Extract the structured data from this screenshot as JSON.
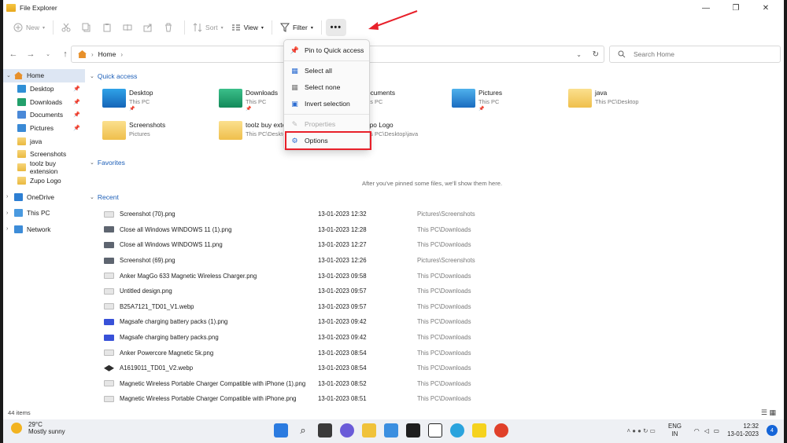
{
  "window": {
    "title": "File Explorer"
  },
  "toolbar": {
    "new_label": "New",
    "sort_label": "Sort",
    "view_label": "View",
    "filter_label": "Filter",
    "more_label": "•••"
  },
  "address": {
    "path": "Home"
  },
  "search": {
    "placeholder": "Search Home"
  },
  "sidebar": {
    "items": [
      {
        "label": "Home",
        "icon": "home-icon"
      },
      {
        "label": "Desktop",
        "icon": "desktop-folder-icon"
      },
      {
        "label": "Downloads",
        "icon": "downloads-folder-icon"
      },
      {
        "label": "Documents",
        "icon": "documents-folder-icon"
      },
      {
        "label": "Pictures",
        "icon": "pictures-folder-icon"
      },
      {
        "label": "java",
        "icon": "folder-icon"
      },
      {
        "label": "Screenshots",
        "icon": "folder-icon"
      },
      {
        "label": "toolz buy extension",
        "icon": "folder-icon"
      },
      {
        "label": "Zupo Logo",
        "icon": "folder-icon"
      },
      {
        "label": "OneDrive",
        "icon": "onedrive-icon"
      },
      {
        "label": "This PC",
        "icon": "pc-icon"
      },
      {
        "label": "Network",
        "icon": "network-icon"
      }
    ]
  },
  "quick_access": {
    "title": "Quick access",
    "tiles": [
      {
        "name": "Desktop",
        "sub": "This PC"
      },
      {
        "name": "Downloads",
        "sub": "This PC"
      },
      {
        "name": "Documents",
        "sub": "This PC"
      },
      {
        "name": "Pictures",
        "sub": "This PC"
      },
      {
        "name": "java",
        "sub": "This PC\\Desktop"
      },
      {
        "name": "Screenshots",
        "sub": "Pictures"
      },
      {
        "name": "toolz buy extension",
        "sub": "This PC\\Desktop"
      },
      {
        "name": "Zupo Logo",
        "sub": "This PC\\Desktop\\java"
      }
    ]
  },
  "favorites": {
    "title": "Favorites",
    "empty_message": "After you've pinned some files, we'll show them here."
  },
  "recent": {
    "title": "Recent",
    "rows": [
      {
        "name": "Screenshot (70).png",
        "date": "13-01-2023 12:32",
        "location": "Pictures\\Screenshots"
      },
      {
        "name": "Close all Windows WINDOWS 11 (1).png",
        "date": "13-01-2023 12:28",
        "location": "This PC\\Downloads"
      },
      {
        "name": "Close all Windows WINDOWS 11.png",
        "date": "13-01-2023 12:27",
        "location": "This PC\\Downloads"
      },
      {
        "name": "Screenshot (69).png",
        "date": "13-01-2023 12:26",
        "location": "Pictures\\Screenshots"
      },
      {
        "name": "Anker MagGo 633 Magnetic Wireless Charger.png",
        "date": "13-01-2023 09:58",
        "location": "This PC\\Downloads"
      },
      {
        "name": "Untitled design.png",
        "date": "13-01-2023 09:57",
        "location": "This PC\\Downloads"
      },
      {
        "name": "B25A7121_TD01_V1.webp",
        "date": "13-01-2023 09:57",
        "location": "This PC\\Downloads"
      },
      {
        "name": "Magsafe charging battery packs (1).png",
        "date": "13-01-2023 09:42",
        "location": "This PC\\Downloads"
      },
      {
        "name": "Magsafe charging battery packs.png",
        "date": "13-01-2023 09:42",
        "location": "This PC\\Downloads"
      },
      {
        "name": "Anker Powercore Magnetic 5k.png",
        "date": "13-01-2023 08:54",
        "location": "This PC\\Downloads"
      },
      {
        "name": "A1619011_TD01_V2.webp",
        "date": "13-01-2023 08:54",
        "location": "This PC\\Downloads"
      },
      {
        "name": "Magnetic Wireless Portable Charger Compatible with iPhone (1).png",
        "date": "13-01-2023 08:52",
        "location": "This PC\\Downloads"
      },
      {
        "name": "Magnetic Wireless Portable Charger Compatible with iPhone.png",
        "date": "13-01-2023 08:51",
        "location": "This PC\\Downloads"
      }
    ]
  },
  "status": {
    "item_count": "44 items"
  },
  "menu": {
    "items": [
      {
        "label": "Pin to Quick access",
        "icon": "pin-icon",
        "enabled": true
      },
      {
        "label": "Select all",
        "icon": "select-all-icon",
        "enabled": true
      },
      {
        "label": "Select none",
        "icon": "select-none-icon",
        "enabled": true
      },
      {
        "label": "Invert selection",
        "icon": "invert-selection-icon",
        "enabled": true
      },
      {
        "label": "Properties",
        "icon": "properties-icon",
        "enabled": false
      },
      {
        "label": "Options",
        "icon": "gear-icon",
        "enabled": true
      }
    ]
  },
  "taskbar": {
    "weather_temp": "29°C",
    "weather_desc": "Mostly sunny",
    "lang_line1": "ENG",
    "lang_line2": "IN",
    "time": "12:32",
    "date": "13-01-2023",
    "notification_count": "4"
  },
  "colors": {
    "accent": "#1d5fb8",
    "highlight_box": "#e8202a",
    "arrow": "#e8202a"
  }
}
